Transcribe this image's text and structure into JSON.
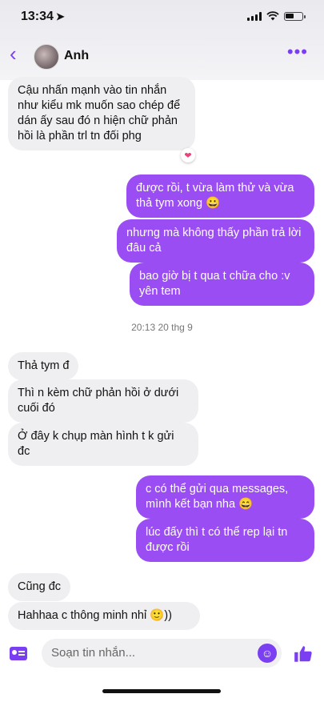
{
  "status_bar": {
    "time": "13:34"
  },
  "header": {
    "contact_name": "Anh"
  },
  "messages": [
    {
      "text": "Cậu nhấn mạnh vào tin nhắn như kiểu mk muốn sao chép để dán ấy sau đó n hiện chữ phản hồi là phần trl tn đối phg"
    },
    {
      "text": "được rồi, t vừa làm thử và vừa thả tym xong 😀"
    },
    {
      "text": "nhưng mà không thấy phần trả lời đâu cả"
    },
    {
      "text": "bao giờ bị t qua t chữa cho :v yên tem"
    },
    {
      "text": "Thả tym đ"
    },
    {
      "text": "Thì n kèm chữ phản hồi ở dưới cuối đó"
    },
    {
      "text": "Ở đây k chụp màn hình t k gửi đc"
    },
    {
      "text": "c có thể gửi qua messages, mình kết bạn nha 😄"
    },
    {
      "text": "lúc đấy thì t có thể rep lại tn được rồi"
    },
    {
      "text": "Cũng đc"
    },
    {
      "text": "Hahhaa c thông minh nhỉ 🙂))"
    }
  ],
  "reaction": "❤",
  "timestamp": "20:13 20 thg 9",
  "composer": {
    "placeholder": "Soạn tin nhắn..."
  },
  "colors": {
    "accent": "#7b3ff2",
    "outgoing_bubble": "#9a4df3",
    "incoming_bubble": "#efeff1"
  }
}
